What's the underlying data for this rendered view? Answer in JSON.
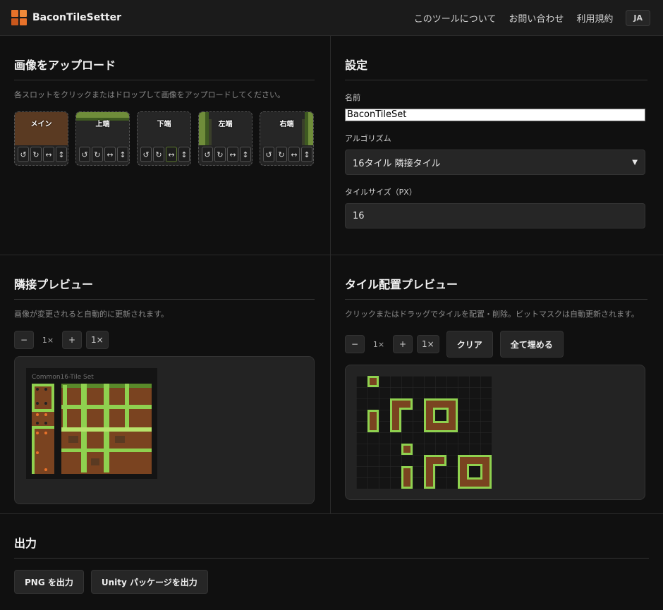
{
  "app": {
    "title": "BaconTileSetter"
  },
  "nav": {
    "about": "このツールについて",
    "contact": "お問い合わせ",
    "terms": "利用規約",
    "lang": "JA"
  },
  "upload": {
    "title": "画像をアップロード",
    "hint": "各スロットをクリックまたはドロップして画像をアップロードしてください。",
    "slots": [
      {
        "label": "メイン"
      },
      {
        "label": "上端"
      },
      {
        "label": "下端"
      },
      {
        "label": "左端"
      },
      {
        "label": "右端"
      }
    ],
    "controls": {
      "rotate_ccw": "↺",
      "rotate_cw": "↻",
      "flip_h": "↔",
      "flip_v": "↕"
    }
  },
  "settings": {
    "title": "設定",
    "name_label": "名前",
    "name_value": "BaconTileSet",
    "algorithm_label": "アルゴリズム",
    "algorithm_value": "16タイル 隣接タイル",
    "tilesize_label": "タイルサイズ（PX）",
    "tilesize_value": "16"
  },
  "adjacency": {
    "title": "隣接プレビュー",
    "hint": "画像が変更されると自動的に更新されます。",
    "zoom_minus": "−",
    "zoom_level": "1×",
    "zoom_plus": "+",
    "zoom_reset": "1×",
    "canvas_caption": "Common16-Tile Set"
  },
  "placement": {
    "title": "タイル配置プレビュー",
    "hint": "クリックまたはドラッグでタイルを配置・削除。ビットマスクは自動更新されます。",
    "zoom_minus": "−",
    "zoom_level": "1×",
    "zoom_plus": "+",
    "zoom_reset": "1×",
    "clear_label": "クリア",
    "fill_label": "全て埋める"
  },
  "output": {
    "title": "出力",
    "png_label": "PNG を出力",
    "unity_label": "Unity パッケージを出力"
  },
  "colors": {
    "accent": "#e8722a",
    "dirt": "#7a4320",
    "grass": "#8fd14f",
    "grass_dark": "#4f7a26"
  }
}
